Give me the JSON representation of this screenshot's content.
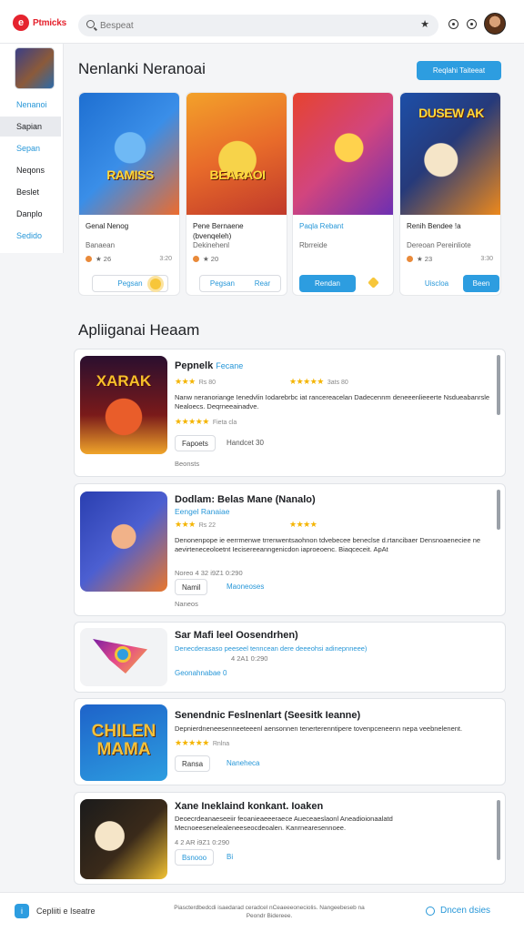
{
  "app": {
    "logo_text": "Ptmicks",
    "logo_glyph": "e"
  },
  "search": {
    "placeholder": "Bespeat",
    "value": ""
  },
  "sidebar": {
    "items": [
      {
        "label": "Nenanoi",
        "active": false,
        "blue": true
      },
      {
        "label": "Sapian",
        "active": true,
        "blue": false
      },
      {
        "label": "Sepan",
        "active": false,
        "blue": true
      },
      {
        "label": "Neqons",
        "active": false,
        "blue": false
      },
      {
        "label": "Beslet",
        "active": false,
        "blue": false
      },
      {
        "label": "Danplo",
        "active": false,
        "blue": false
      },
      {
        "label": "Sedido",
        "active": false,
        "blue": true
      }
    ]
  },
  "featured": {
    "title": "Nenlanki Neranoai",
    "action_label": "Reqlahi Taiteeat",
    "cards": [
      {
        "art_text": "RAMISS",
        "title": "Genal Nenog",
        "title_blue": false,
        "sub": "Banaean",
        "meta": "★ 26",
        "meta_right": "3:20",
        "btn_label": "Pegsan",
        "btn_style": "outline",
        "colors": [
          "#1e6fd1",
          "#f06b2a"
        ]
      },
      {
        "art_text": "BEARAOI",
        "title": "Pene Bernaene (bvenqeleh)",
        "title_blue": false,
        "sub": "Dekinehenl",
        "meta": "★ 20",
        "meta_right": "",
        "btn_label": "Pegsan",
        "btn_label2": "Rear",
        "btn_style": "outline",
        "colors": [
          "#f3a12a",
          "#c0392b"
        ]
      },
      {
        "art_text": "",
        "title": "Paqla Rebant",
        "title_blue": true,
        "sub": "Rbrreide",
        "meta": "",
        "meta_right": "",
        "btn_label": "Rendan",
        "btn_style": "fill",
        "colors": [
          "#e6432f",
          "#6b2fb3"
        ]
      },
      {
        "art_text": "DUSEW AK",
        "title": "Renih Bendee !a",
        "title_blue": false,
        "sub": "Dereoan Pereinliote",
        "meta": "★ 23",
        "meta_right": "3:30",
        "btn_label": "Uiscloa",
        "btn_label2": "Been",
        "btn_style": "split",
        "colors": [
          "#1d4fa8",
          "#f08a1a"
        ]
      }
    ]
  },
  "apps": {
    "title": "Apliiganai Heaam",
    "items": [
      {
        "icon_text": "XARAK",
        "name": "Pepnelk",
        "tag": "Fecane",
        "stars": "★★★",
        "stars_note": "Rs 80",
        "rating2": "★★★★★",
        "rating2_note": "3ats 80",
        "desc": "Nanw neranoriange Ienedvlin Iodarebrbc iat rancereacelan Dadecennm deneeenlieeerte Nsdueabanrsle Nealoecs. Deqrneeainadve.",
        "stars3": "★★★★★",
        "stars3_note": "Fieta cla",
        "btn_label": "Fapoets",
        "meta": "Handcet 30",
        "footer": "Beonsts",
        "colors": [
          "#7a1a1a",
          "#f0a52a"
        ]
      },
      {
        "icon_text": "",
        "name": "Dodlam: Belas Mane (Nanalo)",
        "tag": "",
        "sub": "Eengel Ranaiae",
        "stars": "★★★",
        "stars_note": "Rs 22",
        "rating2": "★★★★",
        "rating2_note": "",
        "desc": "Denonenpope ie eerrmenwe trrenwentsaohnon tdvebecee beneclse d.rtancibaer Densnoaeneciee ne aevirteneceoloetnt Iecisereeanngenicdon iaproeoenc. Biaqceceit. ApAt",
        "meta_inline": "Noreo 4 32  i9Z1 0:290",
        "btn_label": "Namil",
        "meta": "Maoneoses",
        "footer": "Naneos",
        "colors": [
          "#2a3fb0",
          "#e9762c"
        ]
      },
      {
        "icon_text": "",
        "name": "Sar Mafi leel Oosendrhen)",
        "tag": "",
        "sub": "",
        "desc": "Denecderasaso peeseel tenncean dere deeeohsi adinepnneee)",
        "meta_inline": "4 2A1 0:290",
        "link": "Geonahnabae 0",
        "colors": [
          "#f3b23a",
          "#7b1fa2"
        ]
      },
      {
        "icon_text": "CHILEN MAMA",
        "name": "Senendnic Feslnenlart (Seesitk Ieanne)",
        "tag": "",
        "sub": "",
        "desc": "Depnierdneneesenneeteeenl aensonnen tenerterenntipere tovenpceneenn nepa veebnelenent.",
        "stars3": "★★★★★",
        "stars3_note": "Rnlna",
        "btn_label": "Ransa",
        "meta": "Naneheca",
        "colors": [
          "#1e63c9",
          "#f3c13a"
        ]
      },
      {
        "icon_text": "",
        "name": "Xane Ineklaind konkant. Ioaken",
        "tag": "",
        "sub": "",
        "desc": "Deoecrdeanaeseeiir feoanieaeeeraece Aueceaeslaonl Aneadioionaalatd Mecnoeesenelealeneeseocdeoalen. Kanrnearesennoee.",
        "meta_inline": "4 2 AR  i9Z1 0:290",
        "btn_label": "Bsnooo",
        "meta": "Bi",
        "colors": [
          "#1b1b1b",
          "#f2c233"
        ]
      }
    ]
  },
  "bottom": {
    "left_label": "Cepliiti e Iseatre",
    "center_text": "Piascterdbedcdi isaedarad ceradcel nCeaeeeoneciolis. Nangeebeseb na Peondr Bidereee.",
    "right_label": "Dncen dsies"
  }
}
